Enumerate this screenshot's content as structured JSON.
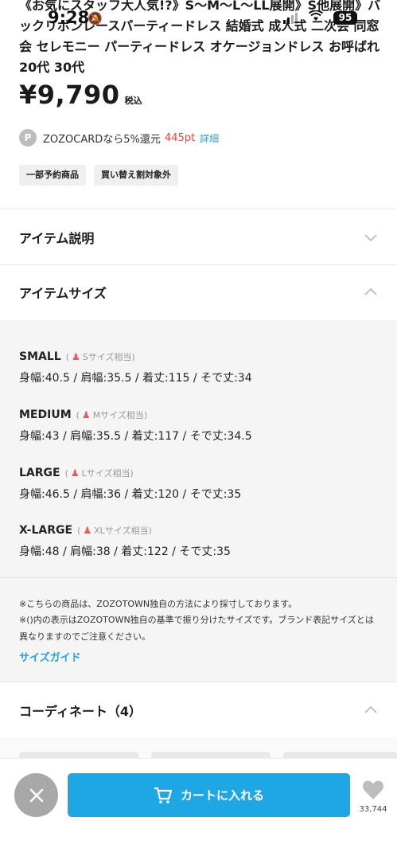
{
  "status_bar": {
    "time": "9:28",
    "battery": "95"
  },
  "product": {
    "title": "《お気にスタッフ大人気!?》S〜M〜L〜LL展開》S他展開》バックリボンレースパーティードレス 結婚式 成人式 二次会 同窓会 セレモニー パーティードレス オケージョンドレス お呼ばれ 20代 30代",
    "price": "¥9,790",
    "tax_label": "税込",
    "zozocard": {
      "icon": "P",
      "text": "ZOZOCARDなら5%還元",
      "points": "445pt",
      "detail_link": "詳細"
    },
    "tags": [
      "一部予約商品",
      "買い替え割対象外"
    ]
  },
  "sections": {
    "item_description": {
      "title": "アイテム説明",
      "expanded": false
    },
    "item_size": {
      "title": "アイテムサイズ",
      "expanded": true
    },
    "coordinate": {
      "title": "コーディネート（4）",
      "expanded": true
    }
  },
  "sizes": [
    {
      "name": "SMALL",
      "equiv": "Sサイズ相当",
      "measurements": "身幅:40.5 / 肩幅:35.5 / 着丈:115 / そで丈:34"
    },
    {
      "name": "MEDIUM",
      "equiv": "Mサイズ相当",
      "measurements": "身幅:43 / 肩幅:35.5 / 着丈:117 / そで丈:34.5"
    },
    {
      "name": "LARGE",
      "equiv": "Lサイズ相当",
      "measurements": "身幅:46.5 / 肩幅:36 / 着丈:120 / そで丈:35"
    },
    {
      "name": "X-LARGE",
      "equiv": "XLサイズ相当",
      "measurements": "身幅:48 / 肩幅:38 / 着丈:122 / そで丈:35"
    }
  ],
  "notes": {
    "line1": "※こちらの商品は、ZOZOTOWN独自の方法により採寸しております。",
    "line2": "※()内の表示はZOZOTOWN独自の基準で振り分けたサイズです。ブランド表記サイズとは異なりますのでご注意ください。",
    "size_guide_link": "サイズガイド"
  },
  "bottom_bar": {
    "cart_label": "カートに入れる",
    "favorite_count": "33,744"
  },
  "colors": {
    "accent": "#1fa6e4",
    "link": "#2aa0d8",
    "points": "#e8473c",
    "panel_bg": "#f5f5f5"
  }
}
